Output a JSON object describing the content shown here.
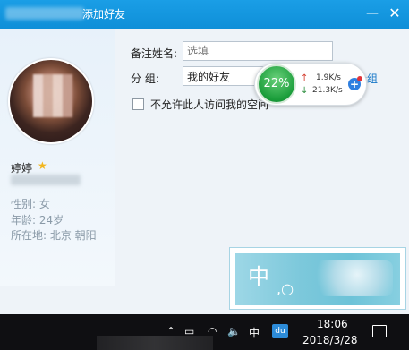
{
  "window": {
    "title": "添加好友"
  },
  "profile": {
    "nickname": "婷婷",
    "gender": "性别: 女",
    "age": "年龄: 24岁",
    "location": "所在地: 北京  朝阳"
  },
  "form": {
    "remark_label": "备注姓名:",
    "remark_placeholder": "选填",
    "group_label": "分    组:",
    "group_value": "我的好友",
    "new_group_link": "分组",
    "block_checkbox_label": "不允许此人访问我的空间"
  },
  "speedball": {
    "percent": "22%",
    "upload": "1.9K/s",
    "download": "21.3K/s"
  },
  "ime": {
    "char": "中"
  },
  "taskbar": {
    "ime_indicator": "中",
    "du_label": "du",
    "time": "18:06",
    "date": "2018/3/28"
  }
}
